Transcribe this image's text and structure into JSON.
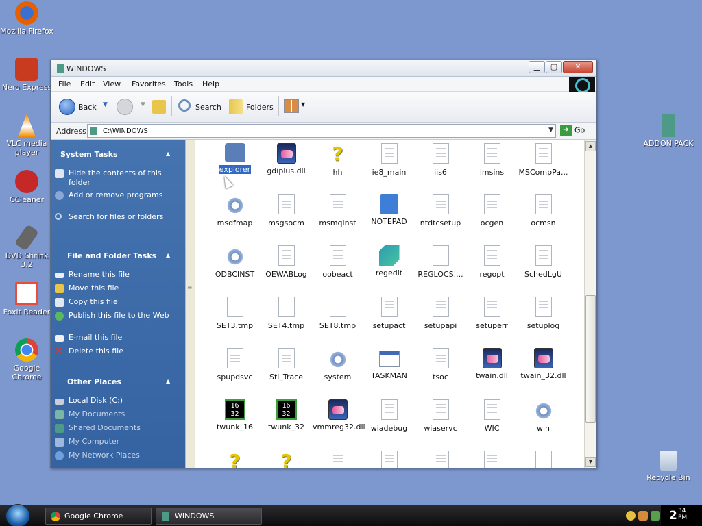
{
  "desktop": {
    "icons": [
      {
        "label": "Mozilla Firefox",
        "color": "#e66000"
      },
      {
        "label": "Nero Express",
        "color": "#c83b1f"
      },
      {
        "label": "VLC media player",
        "color": "#f08a00"
      },
      {
        "label": "CCleaner",
        "color": "#c62828"
      },
      {
        "label": "DVD Shrink 3.2",
        "color": "#666666"
      },
      {
        "label": "Foxit Reader",
        "color": "#e84d3c"
      },
      {
        "label": "Google Chrome",
        "color": "#1c9e4a"
      },
      {
        "label": "ADDON PACK",
        "color": "#4d9a87"
      },
      {
        "label": "Recycle Bin",
        "color": "#b7c8dd"
      }
    ]
  },
  "window": {
    "title": "WINDOWS",
    "menu": [
      "File",
      "Edit",
      "View",
      "Favorites",
      "Tools",
      "Help"
    ],
    "toolbar": {
      "back": "Back",
      "search": "Search",
      "folders": "Folders"
    },
    "address": {
      "label": "Address",
      "value": "C:\\WINDOWS",
      "go": "Go"
    },
    "left_pane": {
      "system_tasks": {
        "title": "System Tasks",
        "items": [
          "Hide the contents of this folder",
          "Add or remove programs",
          "Search for files or folders"
        ]
      },
      "file_tasks": {
        "title": "File and Folder Tasks",
        "items": [
          "Rename this file",
          "Move this file",
          "Copy this file",
          "Publish this file to the Web",
          "E-mail this file",
          "Delete this file"
        ]
      },
      "other_places": {
        "title": "Other Places",
        "items": [
          "Local Disk (C:)",
          "My Documents",
          "Shared Documents",
          "My Computer",
          "My Network Places"
        ]
      }
    },
    "files": [
      {
        "name": "explorer",
        "icon": "exp",
        "selected": true
      },
      {
        "name": "gdiplus.dll",
        "icon": "pic"
      },
      {
        "name": "hh",
        "icon": "help"
      },
      {
        "name": "ie8_main",
        "icon": "doc"
      },
      {
        "name": "iis6",
        "icon": "doc"
      },
      {
        "name": "imsins",
        "icon": "doc"
      },
      {
        "name": "MSCompPa...",
        "icon": "doc"
      },
      {
        "name": "msdfmap",
        "icon": "gear"
      },
      {
        "name": "msgsocm",
        "icon": "doc"
      },
      {
        "name": "msmqinst",
        "icon": "doc"
      },
      {
        "name": "NOTEPAD",
        "icon": "notepad"
      },
      {
        "name": "ntdtcsetup",
        "icon": "doc"
      },
      {
        "name": "ocgen",
        "icon": "doc"
      },
      {
        "name": "ocmsn",
        "icon": "doc"
      },
      {
        "name": "ODBCINST",
        "icon": "gear"
      },
      {
        "name": "OEWABLog",
        "icon": "doc"
      },
      {
        "name": "oobeact",
        "icon": "doc"
      },
      {
        "name": "regedit",
        "icon": "reg"
      },
      {
        "name": "REGLOCS....",
        "icon": "blank"
      },
      {
        "name": "regopt",
        "icon": "doc"
      },
      {
        "name": "SchedLgU",
        "icon": "doc"
      },
      {
        "name": "SET3.tmp",
        "icon": "blank"
      },
      {
        "name": "SET4.tmp",
        "icon": "blank"
      },
      {
        "name": "SET8.tmp",
        "icon": "blank"
      },
      {
        "name": "setupact",
        "icon": "doc"
      },
      {
        "name": "setupapi",
        "icon": "doc"
      },
      {
        "name": "setuperr",
        "icon": "doc"
      },
      {
        "name": "setuplog",
        "icon": "doc"
      },
      {
        "name": "spupdsvc",
        "icon": "doc"
      },
      {
        "name": "Sti_Trace",
        "icon": "doc"
      },
      {
        "name": "system",
        "icon": "gear"
      },
      {
        "name": "TASKMAN",
        "icon": "taskman"
      },
      {
        "name": "tsoc",
        "icon": "doc"
      },
      {
        "name": "twain.dll",
        "icon": "pic"
      },
      {
        "name": "twain_32.dll",
        "icon": "pic"
      },
      {
        "name": "twunk_16",
        "icon": "w16"
      },
      {
        "name": "twunk_32",
        "icon": "w16"
      },
      {
        "name": "vmmreg32.dll",
        "icon": "pic"
      },
      {
        "name": "wiadebug",
        "icon": "doc"
      },
      {
        "name": "wiaservc",
        "icon": "doc"
      },
      {
        "name": "WIC",
        "icon": "doc"
      },
      {
        "name": "win",
        "icon": "gear"
      },
      {
        "name": "",
        "icon": "help"
      },
      {
        "name": "",
        "icon": "help"
      },
      {
        "name": "",
        "icon": "doc"
      },
      {
        "name": "",
        "icon": "doc"
      },
      {
        "name": "",
        "icon": "doc"
      },
      {
        "name": "",
        "icon": "doc"
      },
      {
        "name": "",
        "icon": "blank"
      }
    ]
  },
  "taskbar": {
    "buttons": [
      "Google Chrome",
      "WINDOWS"
    ],
    "clock_hour": "2",
    "clock_minute": "34",
    "clock_ampm": "PM"
  }
}
